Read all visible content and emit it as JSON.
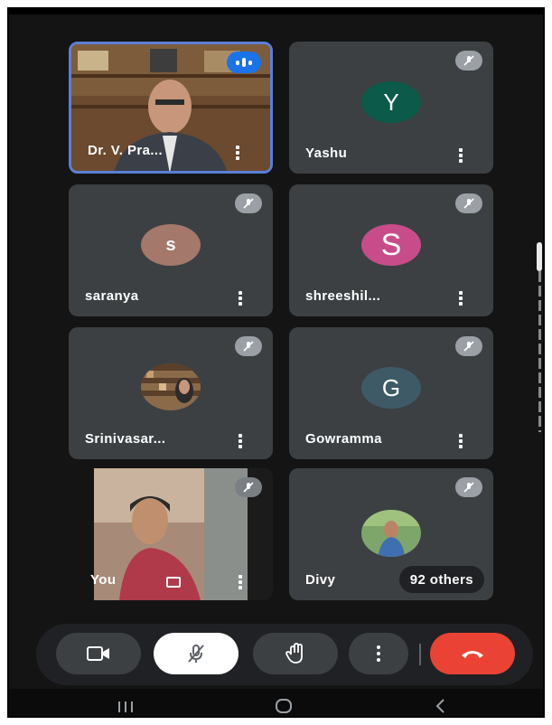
{
  "participants": [
    {
      "name": "Dr. V. Pra...",
      "speaking": true
    },
    {
      "name": "Yashu",
      "initial": "Y",
      "avatar_color": "#0b5a4a"
    },
    {
      "name": "saranya",
      "initial": "s",
      "avatar_color": "#a4786b"
    },
    {
      "name": "shreeshil...",
      "initial": "S",
      "avatar_color": "#c94c8a"
    },
    {
      "name": "Srinivasar..."
    },
    {
      "name": "Gowramma",
      "initial": "G",
      "avatar_color": "#3e5a66"
    },
    {
      "name": "You"
    },
    {
      "name": "Divy",
      "others_label": "92 others"
    }
  ],
  "controls": [
    "camera-button",
    "mic-toggle-button",
    "raise-hand-button",
    "more-options-button",
    "end-call-button"
  ],
  "colors": {
    "tile_bg": "#3c4043",
    "end_call": "#ea4335",
    "active_border": "#5b7fd6",
    "speaking_badge": "#1a73e8"
  }
}
